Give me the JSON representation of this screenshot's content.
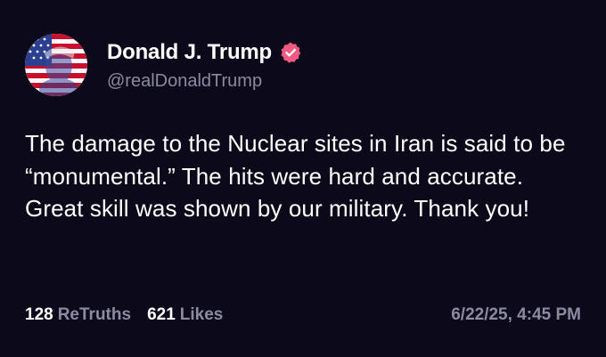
{
  "author": {
    "display_name": "Donald J. Trump",
    "handle": "@realDonaldTrump",
    "verified": true,
    "verified_color": "#f15a82"
  },
  "post": {
    "text": "The damage to the Nuclear sites in Iran is said to be “monumental.” The hits were hard and accurate. Great skill was shown by our military. Thank you!"
  },
  "stats": {
    "retruths_count": "128",
    "retruths_label": "ReTruths",
    "likes_count": "621",
    "likes_label": "Likes"
  },
  "timestamp": "6/22/25, 4:45 PM",
  "colors": {
    "background": "#0c0a1a",
    "text": "#ffffff",
    "muted": "#8b8aa0"
  }
}
